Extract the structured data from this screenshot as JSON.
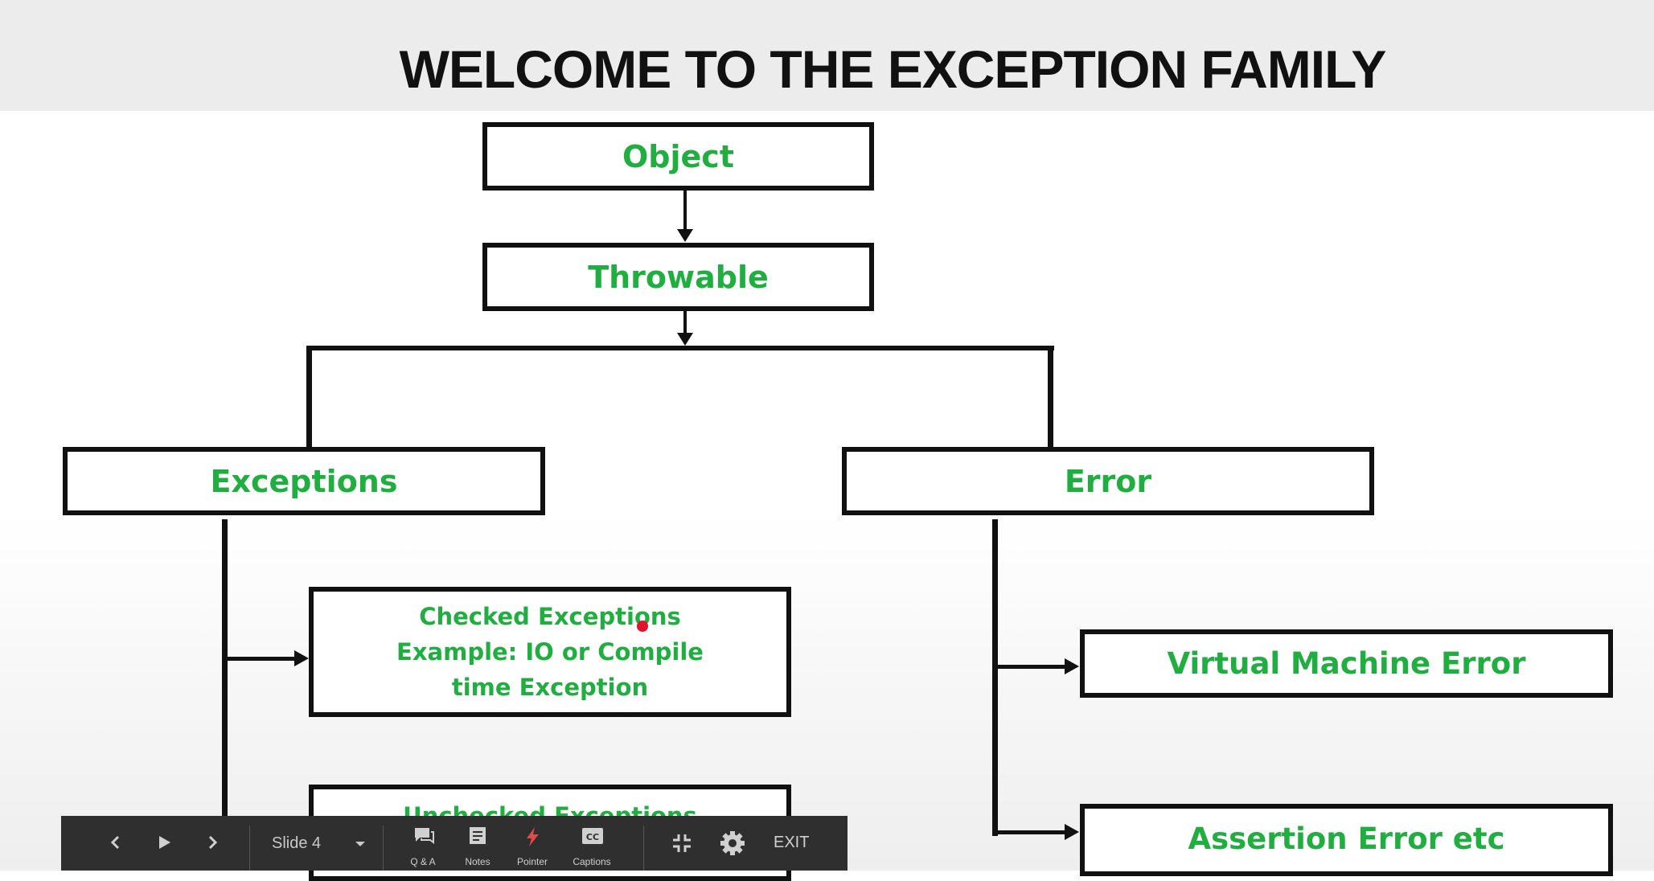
{
  "slide": {
    "title": "WELCOME TO THE EXCEPTION FAMILY",
    "text_color": "#1fae3f",
    "nodes": {
      "object": "Object",
      "throwable": "Throwable",
      "exceptions": "Exceptions",
      "error": "Error",
      "checked": [
        "Checked Exceptions",
        "Example: IO or Compile",
        "time Exception"
      ],
      "unchecked": "Unchecked Exceptions",
      "vm_error": "Virtual Machine Error",
      "assertion_error": "Assertion Error etc"
    }
  },
  "toolbar": {
    "slide_label": "Slide 4",
    "qa_label": "Q & A",
    "notes_label": "Notes",
    "pointer_label": "Pointer",
    "captions_label": "Captions",
    "exit_label": "EXIT",
    "icons": [
      "chevron-left-icon",
      "play-icon",
      "chevron-right-icon",
      "caret-down-icon",
      "chat-icon",
      "notes-icon",
      "pointer-icon",
      "captions-icon",
      "exit-fullscreen-icon",
      "gear-icon"
    ]
  }
}
